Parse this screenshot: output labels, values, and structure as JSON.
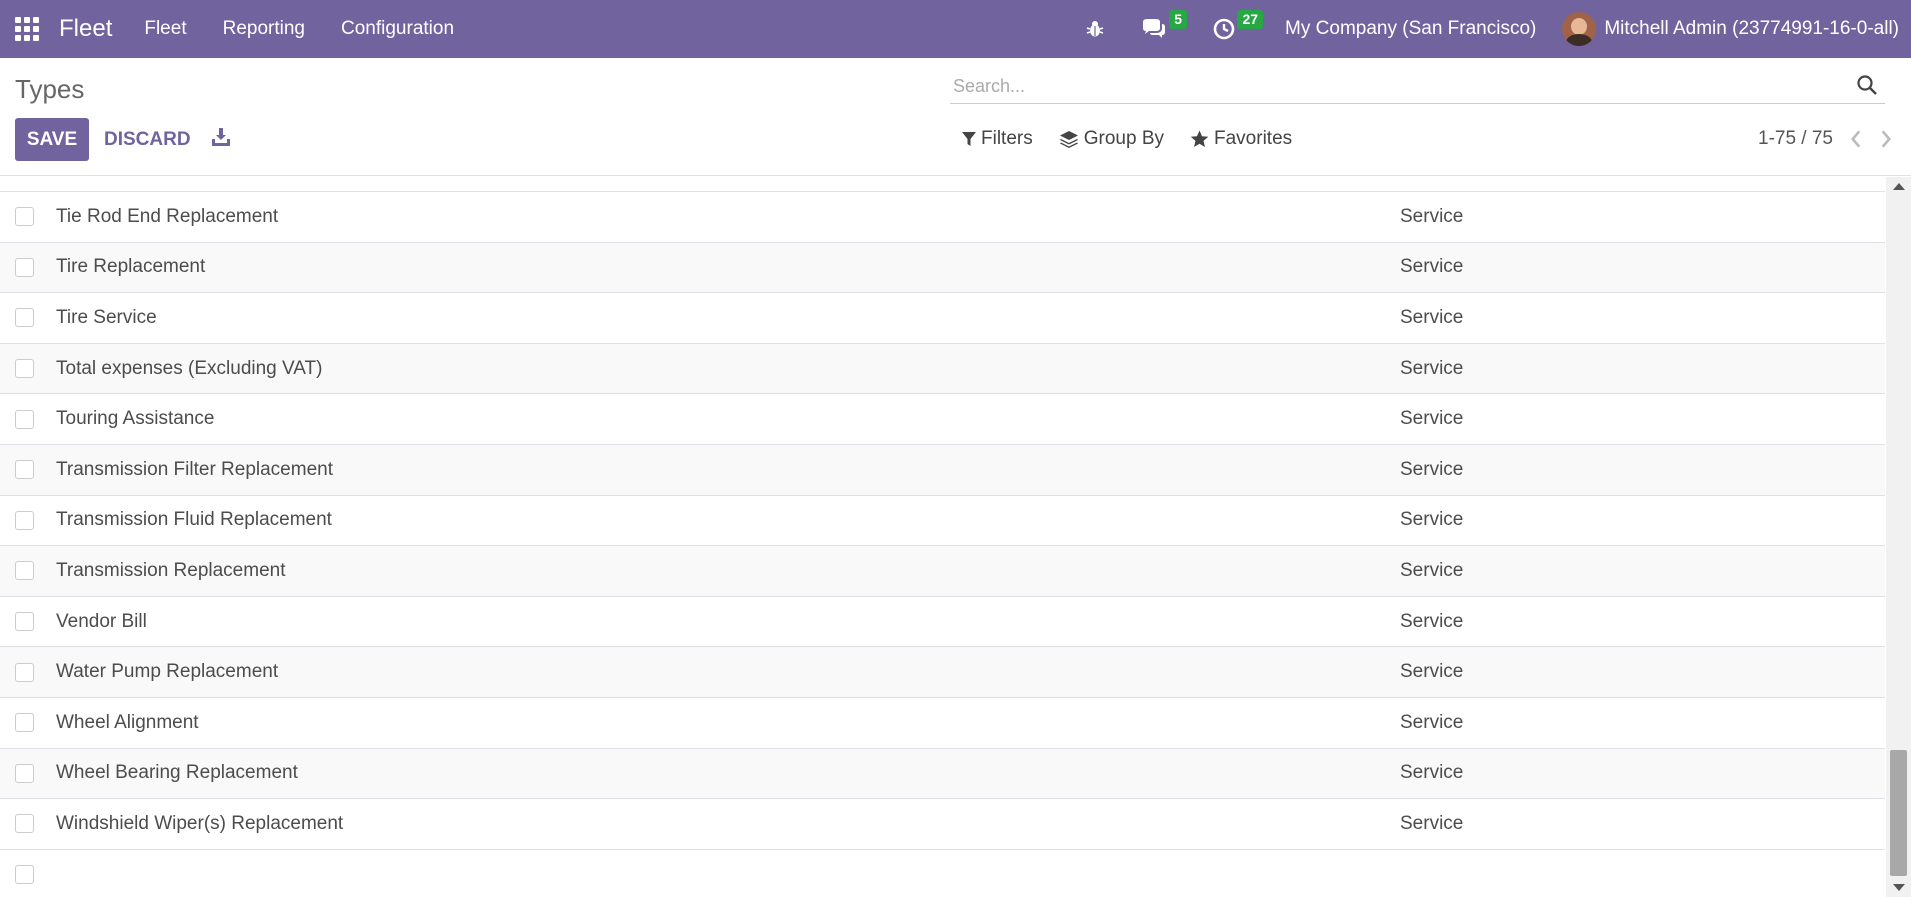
{
  "navbar": {
    "brand": "Fleet",
    "menu": [
      "Fleet",
      "Reporting",
      "Configuration"
    ],
    "messages_count": "5",
    "activities_count": "27",
    "company": "My Company (San Francisco)",
    "user": "Mitchell Admin (23774991-16-0-all)",
    "color": "#71639e",
    "badge_color": "#28a745"
  },
  "control_panel": {
    "title": "Types",
    "save_label": "SAVE",
    "discard_label": "DISCARD",
    "search_placeholder": "Search...",
    "filters_label": "Filters",
    "groupby_label": "Group By",
    "favorites_label": "Favorites",
    "pager": "1-75 / 75"
  },
  "list": {
    "rows": [
      {
        "name": "Tie Rod End Replacement",
        "category": "Service"
      },
      {
        "name": "Tire Replacement",
        "category": "Service"
      },
      {
        "name": "Tire Service",
        "category": "Service"
      },
      {
        "name": "Total expenses (Excluding VAT)",
        "category": "Service"
      },
      {
        "name": "Touring Assistance",
        "category": "Service"
      },
      {
        "name": "Transmission Filter Replacement",
        "category": "Service"
      },
      {
        "name": "Transmission Fluid Replacement",
        "category": "Service"
      },
      {
        "name": "Transmission Replacement",
        "category": "Service"
      },
      {
        "name": "Vendor Bill",
        "category": "Service"
      },
      {
        "name": "Water Pump Replacement",
        "category": "Service"
      },
      {
        "name": "Wheel Alignment",
        "category": "Service"
      },
      {
        "name": "Wheel Bearing Replacement",
        "category": "Service"
      },
      {
        "name": "Windshield Wiper(s) Replacement",
        "category": "Service"
      }
    ]
  },
  "icons": {
    "apps": "apps-grid-icon",
    "debug": "bug-icon",
    "messages": "chat-icon",
    "activities": "clock-icon",
    "export": "download-icon",
    "search": "search-icon",
    "filter": "filter-icon",
    "groupby": "layers-icon",
    "favorites": "star-icon"
  }
}
